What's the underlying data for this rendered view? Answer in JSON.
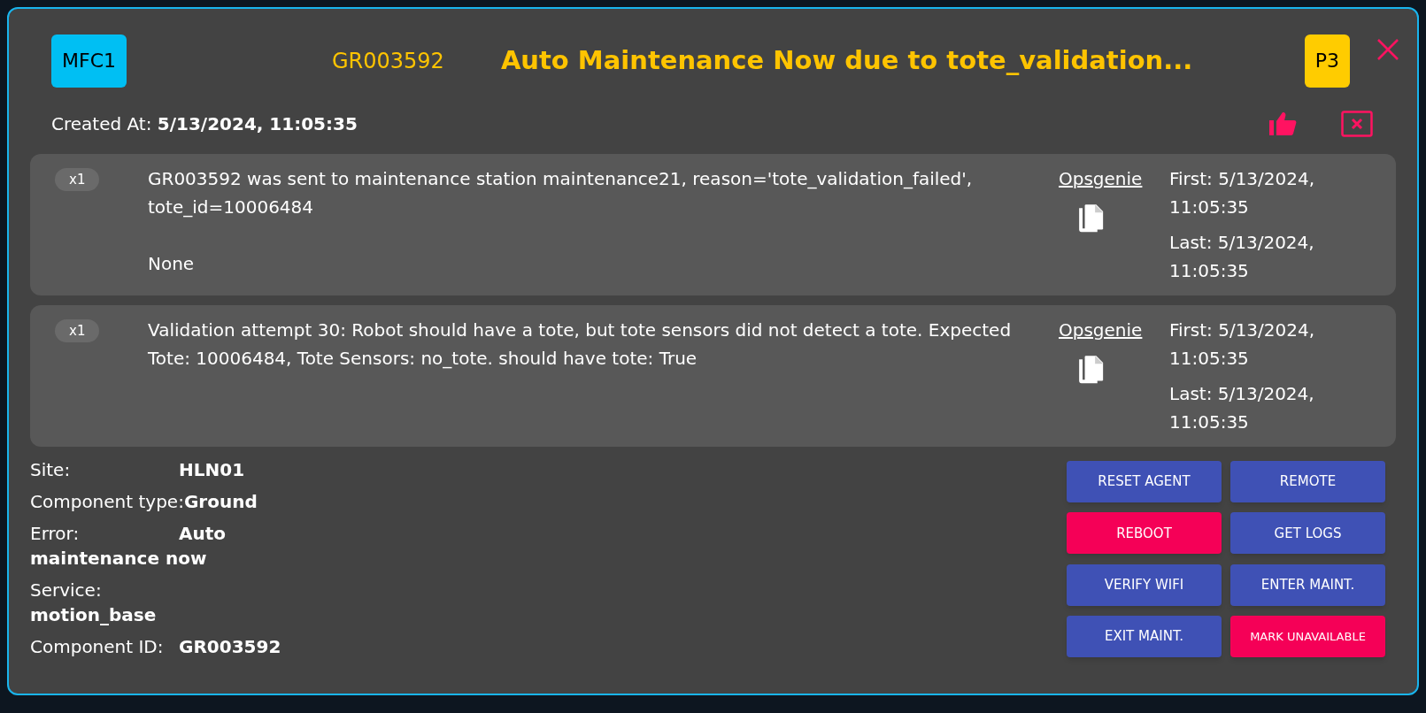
{
  "header": {
    "site_chip": "MFC1",
    "robot_id": "GR003592",
    "title": "Auto Maintenance Now due to tote_validation...",
    "priority": "P3"
  },
  "created": {
    "label": "Created At:",
    "value": "5/13/2024, 11:05:35"
  },
  "events": [
    {
      "count": "x1",
      "message": "GR003592 was sent to maintenance station maintenance21, reason='tote_validation_failed', tote_id=10006484",
      "detail": "None",
      "link": "Opsgenie",
      "first": "First: 5/13/2024, 11:05:35",
      "last": "Last: 5/13/2024, 11:05:35"
    },
    {
      "count": "x1",
      "message": "Validation attempt 30: Robot should have a tote, but tote sensors did not detect a tote. Expected Tote: 10006484, Tote Sensors: no_tote. should have tote: True",
      "link": "Opsgenie",
      "first": "First: 5/13/2024, 11:05:35",
      "last": "Last: 5/13/2024, 11:05:35"
    }
  ],
  "details": [
    {
      "label": "Site:",
      "value": "HLN01"
    },
    {
      "label": "Component type:",
      "value": "Ground"
    },
    {
      "label": "Error:",
      "value": "Auto maintenance now"
    },
    {
      "label": "Service:",
      "value": "motion_base"
    },
    {
      "label": "Component ID:",
      "value": "GR003592"
    }
  ],
  "actions": [
    {
      "label": "RESET AGENT",
      "kind": "normal"
    },
    {
      "label": "REMOTE",
      "kind": "normal"
    },
    {
      "label": "REBOOT",
      "kind": "danger"
    },
    {
      "label": "GET LOGS",
      "kind": "normal"
    },
    {
      "label": "VERIFY WIFI",
      "kind": "normal"
    },
    {
      "label": "ENTER MAINT.",
      "kind": "normal"
    },
    {
      "label": "EXIT MAINT.",
      "kind": "normal"
    },
    {
      "label": "MARK UNAVAILABLE",
      "kind": "danger"
    }
  ]
}
